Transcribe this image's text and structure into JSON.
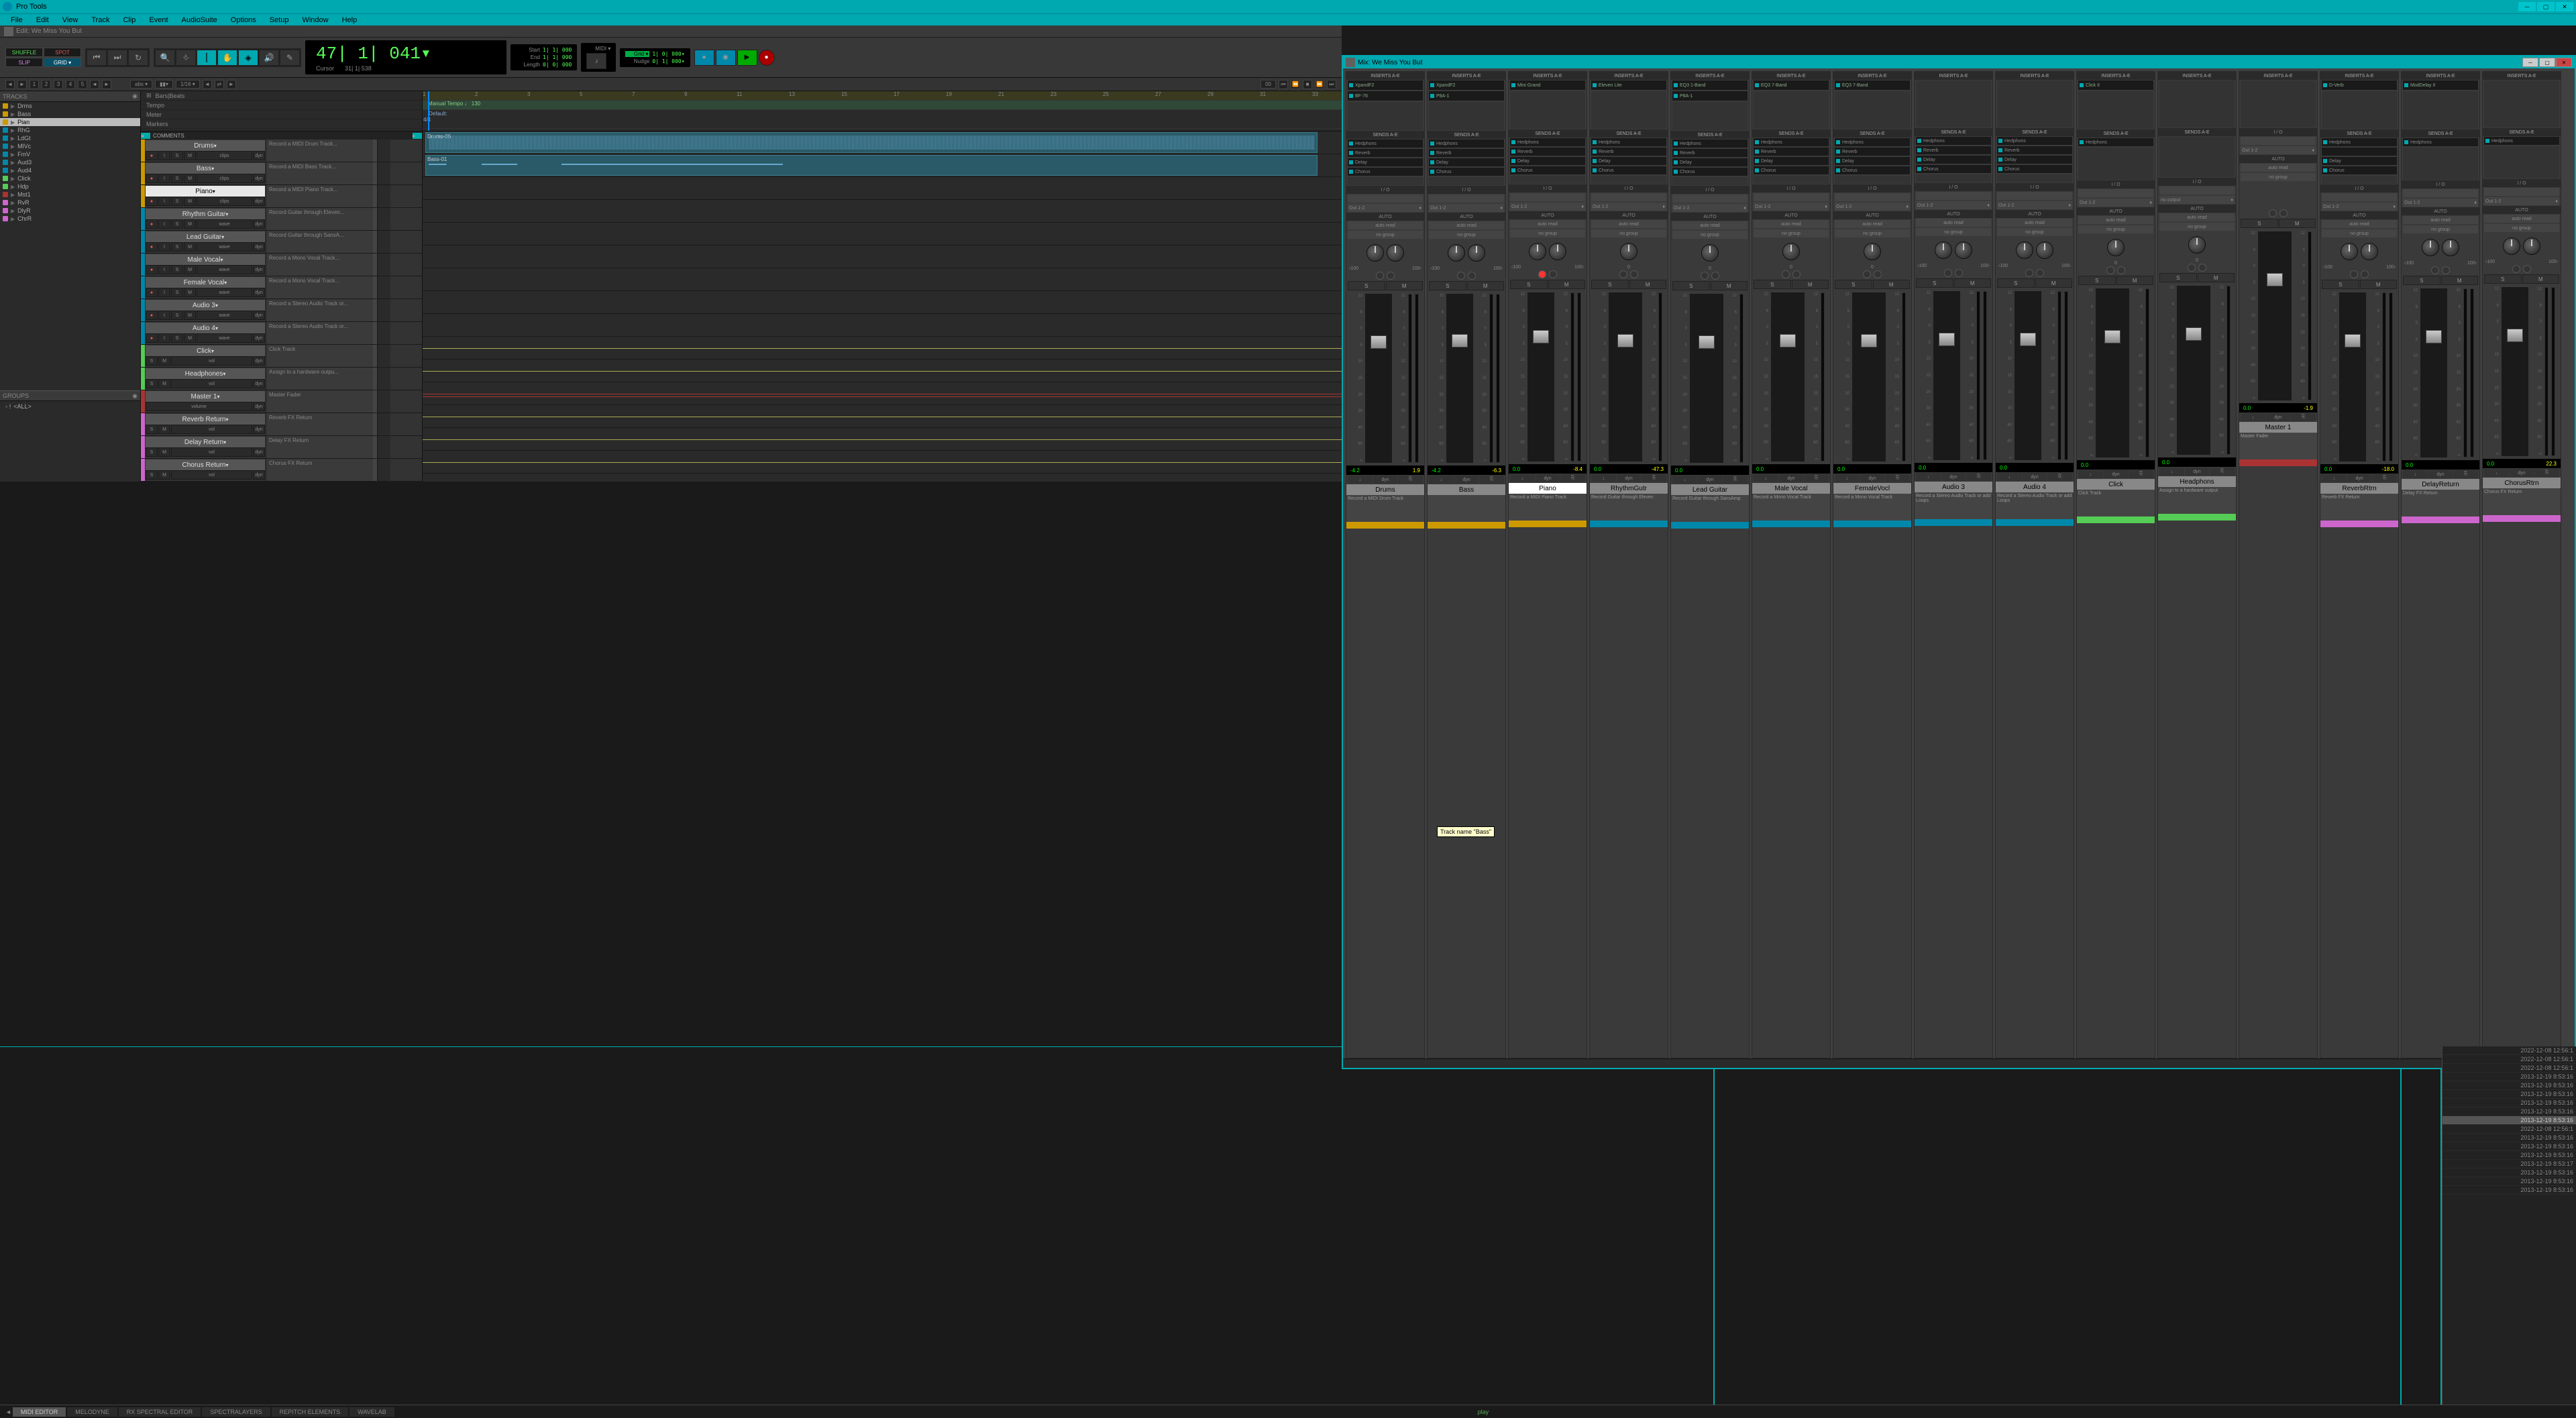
{
  "app": {
    "title": "Pro Tools"
  },
  "menu": [
    "File",
    "Edit",
    "View",
    "Track",
    "Clip",
    "Event",
    "AudioSuite",
    "Options",
    "Setup",
    "Window",
    "Help"
  ],
  "edit_window": {
    "title": "Edit: We Miss You But"
  },
  "mix_window": {
    "title": "Mix: We Miss You But"
  },
  "modes": {
    "shuffle": "SHUFFLE",
    "spot": "SPOT",
    "slip": "SLIP",
    "grid": "GRID ▾"
  },
  "counter": {
    "main": "47| 1| 041▾",
    "cursor_label": "Cursor",
    "cursor_val": "31| 1| 538"
  },
  "transport": {
    "start_label": "Start",
    "start_val": "1| 1| 000",
    "end_label": "End",
    "end_val": "1| 1| 000",
    "length_label": "Length",
    "length_val": "0| 0| 000",
    "grid_label": "Grid ▾",
    "grid_val": "1| 0| 000▾",
    "nudge_label": "Nudge",
    "nudge_val": "0| 1| 000▾",
    "midi_label": "MIDI ▾"
  },
  "sub_toolbar": {
    "nums": [
      "1",
      "2",
      "3",
      "4",
      "5"
    ],
    "abs": "abs ▾",
    "bar": "▮▮▾",
    "sixteenth": "1/16 ▾",
    "link": "00"
  },
  "tracks_panel": {
    "header": "TRACKS",
    "groups_header": "GROUPS",
    "groups_all": "<ALL>",
    "items": [
      {
        "name": "Drms",
        "color": "#c90"
      },
      {
        "name": "Bass",
        "color": "#c90"
      },
      {
        "name": "Pian",
        "color": "#c90",
        "selected": true
      },
      {
        "name": "RhG",
        "color": "#08a"
      },
      {
        "name": "LdGt",
        "color": "#08a"
      },
      {
        "name": "MlVc",
        "color": "#08a"
      },
      {
        "name": "FmV",
        "color": "#08a"
      },
      {
        "name": "Aud3",
        "color": "#08a"
      },
      {
        "name": "Aud4",
        "color": "#08a"
      },
      {
        "name": "Click",
        "color": "#5c5"
      },
      {
        "name": "Hdp",
        "color": "#5c5"
      },
      {
        "name": "Mst1",
        "color": "#a33"
      },
      {
        "name": "RvR",
        "color": "#c6c"
      },
      {
        "name": "DlyR",
        "color": "#c6c"
      },
      {
        "name": "ChrR",
        "color": "#c6c"
      }
    ]
  },
  "rulers": {
    "bars_label": "Bars|Beats",
    "tempo_label": "Tempo",
    "tempo_val": "Manual Tempo    ♩ 130",
    "meter_label": "Meter",
    "meter_val": "Default: 4/4",
    "markers_label": "Markers",
    "ticks": [
      "1",
      "2",
      "3",
      "5",
      "7",
      "9",
      "11",
      "13",
      "15",
      "17",
      "19",
      "21",
      "23",
      "25",
      "27",
      "29",
      "31",
      "33"
    ]
  },
  "comments_header": "COMMENTS",
  "edit_tracks": [
    {
      "name": "Drums",
      "color": "#c90",
      "ctrls": {
        "rec": "●",
        "i": "I",
        "s": "S",
        "m": "M",
        "wave": "clips",
        "dyn": "dyn"
      },
      "comment": "Record a MIDI Drum Track...",
      "clip": "Drums-06"
    },
    {
      "name": "Bass",
      "color": "#c90",
      "ctrls": {
        "rec": "●",
        "i": "I",
        "s": "S",
        "m": "M",
        "wave": "clips",
        "dyn": "dyn"
      },
      "comment": "Record a MIDI Bass Track...",
      "clip": "Bass-01"
    },
    {
      "name": "Piano",
      "color": "#c90",
      "selected": true,
      "ctrls": {
        "rec": "●",
        "i": "I",
        "s": "S",
        "m": "M",
        "wave": "clips",
        "dyn": "dyn"
      },
      "comment": "Record a MIDI Piano Track..."
    },
    {
      "name": "Rhythm Guitar",
      "color": "#08a",
      "ctrls": {
        "rec": "●",
        "i": "I",
        "s": "S",
        "m": "M",
        "wave": "wave",
        "dyn": "dyn"
      },
      "comment": "Record Guitar through Eleven..."
    },
    {
      "name": "Lead Guitar",
      "color": "#08a",
      "ctrls": {
        "rec": "●",
        "i": "I",
        "s": "S",
        "m": "M",
        "wave": "wave",
        "dyn": "dyn"
      },
      "comment": "Record Guitar through SansA..."
    },
    {
      "name": "Male Vocal",
      "color": "#08a",
      "ctrls": {
        "rec": "●",
        "i": "I",
        "s": "S",
        "m": "M",
        "wave": "wave",
        "dyn": "dyn"
      },
      "comment": "Record a Mono Vocal Track..."
    },
    {
      "name": "Female Vocal",
      "color": "#08a",
      "ctrls": {
        "rec": "●",
        "i": "I",
        "s": "S",
        "m": "M",
        "wave": "wave",
        "dyn": "dyn"
      },
      "comment": "Record a Mono Vocal Track..."
    },
    {
      "name": "Audio 3",
      "color": "#08a",
      "ctrls": {
        "rec": "●",
        "i": "I",
        "s": "S",
        "m": "M",
        "wave": "wave",
        "dyn": "dyn"
      },
      "comment": "Record a Stereo Audio Track or..."
    },
    {
      "name": "Audio 4",
      "color": "#08a",
      "ctrls": {
        "rec": "●",
        "i": "I",
        "s": "S",
        "m": "M",
        "wave": "wave",
        "dyn": "dyn"
      },
      "comment": "Record a Stereo Audio Track or..."
    },
    {
      "name": "Click",
      "color": "#5c5",
      "ctrls": {
        "s": "S",
        "m": "M",
        "vol": "vol",
        "dyn": "dyn"
      },
      "comment": "Click Track",
      "line": true
    },
    {
      "name": "Headphones",
      "color": "#5c5",
      "ctrls": {
        "s": "S",
        "m": "M",
        "vol": "vol",
        "dyn": "dyn"
      },
      "comment": "Assign to a hardware outpu...",
      "line": true
    },
    {
      "name": "Master 1",
      "color": "#a33",
      "ctrls": {
        "vol": "volume",
        "dyn": "dyn"
      },
      "comment": "Master Fader",
      "line": true
    },
    {
      "name": "Reverb Return",
      "color": "#c6c",
      "ctrls": {
        "s": "S",
        "m": "M",
        "vol": "vol",
        "dyn": "dyn"
      },
      "comment": "Reverb FX Return",
      "line": true
    },
    {
      "name": "Delay Return",
      "color": "#c6c",
      "ctrls": {
        "s": "S",
        "m": "M",
        "vol": "vol",
        "dyn": "dyn"
      },
      "comment": "Delay FX Return",
      "line": true
    },
    {
      "name": "Chorus Return",
      "color": "#c6c",
      "ctrls": {
        "s": "S",
        "m": "M",
        "vol": "vol",
        "dyn": "dyn"
      },
      "comment": "Chorus FX Return",
      "line": true
    }
  ],
  "bottom_tabs": [
    "MIDI EDITOR",
    "MELODYNE",
    "RX SPECTRAL EDITOR",
    "SPECTRALAYERS",
    "REPITCH ELEMENTS",
    "WAVELAB"
  ],
  "play_label": "play",
  "mix": {
    "inserts_label": "INSERTS A-E",
    "sends_label": "SENDS A-E",
    "io_label": "I / O",
    "auto_label": "AUTO",
    "auto_read": "auto read",
    "nogroup": "no group",
    "tooltip": "Track name \"Bass\"",
    "channels": [
      {
        "name": "Drums",
        "color": "#c90",
        "inserts": [
          "XpandF2",
          "BF-76"
        ],
        "sends": [
          "Hedphons",
          "Reverb",
          "Delay",
          "Chorus"
        ],
        "in": "",
        "out": "Out 1-2",
        "fader": 62,
        "pan": [
          "‹100",
          "100›"
        ],
        "level": {
          "vol": "-4.2",
          "pk": "1.9"
        },
        "comment": "Record a MIDI Drum Track"
      },
      {
        "name": "Bass",
        "color": "#c90",
        "inserts": [
          "XpandF2",
          "P8A-1"
        ],
        "sends": [
          "Hedphons",
          "Reverb",
          "Delay",
          "Chorus"
        ],
        "in": "",
        "out": "Out 1-2",
        "fader": 60,
        "pan": [
          "‹100",
          "100›"
        ],
        "level": {
          "vol": "-4.2",
          "pk": "-6.3"
        },
        "comment": ""
      },
      {
        "name": "Piano",
        "color": "#c90",
        "selected": true,
        "inserts": [
          "Mini Grand"
        ],
        "sends": [
          "Hedphons",
          "Reverb",
          "Delay",
          "Chorus"
        ],
        "in": "",
        "out": "Out 1-2",
        "fader": 56,
        "rec": true,
        "pan": [
          "‹100",
          "100›"
        ],
        "level": {
          "vol": "0.0",
          "pk": "-8.4"
        },
        "comment": "Record a MIDI Piano Track"
      },
      {
        "name": "RhythmGutr",
        "color": "#08a",
        "inserts": [
          "Eleven Lite"
        ],
        "sends": [
          "Hedphons",
          "Reverb",
          "Delay",
          "Chorus"
        ],
        "in": "",
        "out": "Out 1-2",
        "fader": 62,
        "pan": [
          "0"
        ],
        "level": {
          "vol": "0.0",
          "pk": "-47.3"
        },
        "comment": "Record Guitar through Eleven"
      },
      {
        "name": "Lead Guitar",
        "color": "#08a",
        "inserts": [
          "EQ3 1-Band",
          "P8A-1"
        ],
        "sends": [
          "Hedphons",
          "Reverb",
          "Delay",
          "Chorus"
        ],
        "in": "",
        "out": "Out 1-2",
        "fader": 62,
        "pan": [
          "0"
        ],
        "level": {
          "vol": "0.0",
          "pk": ""
        },
        "comment": "Record Guitar through SansAmp"
      },
      {
        "name": "Male Vocal",
        "color": "#08a",
        "inserts": [
          "EQ3 7-Band"
        ],
        "sends": [
          "Hedphons",
          "Reverb",
          "Delay",
          "Chorus"
        ],
        "in": "",
        "out": "Out 1-2",
        "fader": 62,
        "pan": [
          "0"
        ],
        "level": {
          "vol": "0.0",
          "pk": ""
        },
        "comment": "Record a Mono Vocal Track"
      },
      {
        "name": "FemaleVocl",
        "color": "#08a",
        "inserts": [
          "EQ3 7-Band"
        ],
        "sends": [
          "Hedphons",
          "Reverb",
          "Delay",
          "Chorus"
        ],
        "in": "",
        "out": "Out 1-2",
        "fader": 62,
        "pan": [
          "0"
        ],
        "level": {
          "vol": "0.0",
          "pk": ""
        },
        "comment": "Record a Mono Vocal Track"
      },
      {
        "name": "Audio 3",
        "color": "#08a",
        "inserts": [],
        "sends": [
          "Hedphons",
          "Reverb",
          "Delay",
          "Chorus"
        ],
        "in": "",
        "out": "Out 1-2",
        "fader": 62,
        "pan": [
          "‹100",
          "100›"
        ],
        "level": {
          "vol": "0.0",
          "pk": ""
        },
        "comment": "Record a Stereo Audio Track or add Loops"
      },
      {
        "name": "Audio 4",
        "color": "#08a",
        "inserts": [],
        "sends": [
          "Hedphons",
          "Reverb",
          "Delay",
          "Chorus"
        ],
        "in": "",
        "out": "Out 1-2",
        "fader": 62,
        "pan": [
          "‹100",
          "100›"
        ],
        "level": {
          "vol": "0.0",
          "pk": ""
        },
        "comment": "Record a Stereo Audio Track or add Loops"
      },
      {
        "name": "Click",
        "color": "#5c5",
        "inserts": [
          "Click II"
        ],
        "sends": [
          "Hedphons"
        ],
        "in": "",
        "out": "Out 1-2",
        "fader": 62,
        "pan": [
          "0"
        ],
        "level": {
          "vol": "0.0",
          "pk": ""
        },
        "comment": "Click Track"
      },
      {
        "name": "Headphons",
        "color": "#5c5",
        "inserts": [],
        "sends": [],
        "in": "",
        "out": "no output",
        "fader": 62,
        "pan": [
          "0"
        ],
        "level": {
          "vol": "0.0",
          "pk": ""
        },
        "comment": "Assign to a hardware output"
      },
      {
        "name": "Master 1",
        "color": "#a33",
        "master": true,
        "inserts": [],
        "sends": [],
        "in": "",
        "out": "Out 1-2",
        "fader": 62,
        "pan": [],
        "level": {
          "vol": "0.0",
          "pk": "-1.9"
        },
        "comment": "Master Fader"
      },
      {
        "name": "ReverbRtrn",
        "color": "#c6c",
        "inserts": [
          "D-Verb"
        ],
        "sends": [
          "Hedphons",
          "",
          "Delay",
          "Chorus"
        ],
        "in": "",
        "out": "Out 1-2",
        "fader": 62,
        "pan": [
          "‹100",
          "100›"
        ],
        "level": {
          "vol": "0.0",
          "pk": "-18.0"
        },
        "comment": "Reverb FX Return"
      },
      {
        "name": "DelayReturn",
        "color": "#c6c",
        "inserts": [
          "ModDelay II"
        ],
        "sends": [
          "Hedphons"
        ],
        "in": "",
        "out": "Out 1-2",
        "fader": 62,
        "pan": [
          "‹100",
          "100›"
        ],
        "level": {
          "vol": "0.0",
          "pk": ""
        },
        "comment": "Delay FX Return"
      },
      {
        "name": "ChorusRtrn",
        "color": "#c6c",
        "inserts": [],
        "sends": [
          "Hedphons"
        ],
        "in": "",
        "out": "Out 1-2",
        "fader": 62,
        "pan": [
          "‹100",
          "100›"
        ],
        "level": {
          "vol": "0.0",
          "pk": "22.3"
        },
        "comment": "Chorus FX Return"
      }
    ]
  },
  "fader_scale": [
    "12",
    "6",
    "0",
    "5",
    "10",
    "15",
    "20",
    "30",
    "40",
    "60",
    "∞"
  ],
  "timestamps": [
    "2022-12-08 12:56:1",
    "2022-12-08 12:56:1",
    "2022-12-08 12:56:1",
    "2013-12-19 8:53:16",
    "2013-12-19 8:53:16",
    "2013-12-19 8:53:16",
    "2013-12-19 8:53:16",
    "2013-12-19 8:53:16",
    "2013-12-19 8:53:16",
    "2022-12-08 12:56:1",
    "2013-12-19 8:53:16",
    "2013-12-19 8:53:16",
    "2013-12-19 8:53:16",
    "2013-12-19 8:53:17",
    "2013-12-19 8:53:16",
    "2013-12-19 8:53:16",
    "2013-12-19 8:53:16"
  ]
}
